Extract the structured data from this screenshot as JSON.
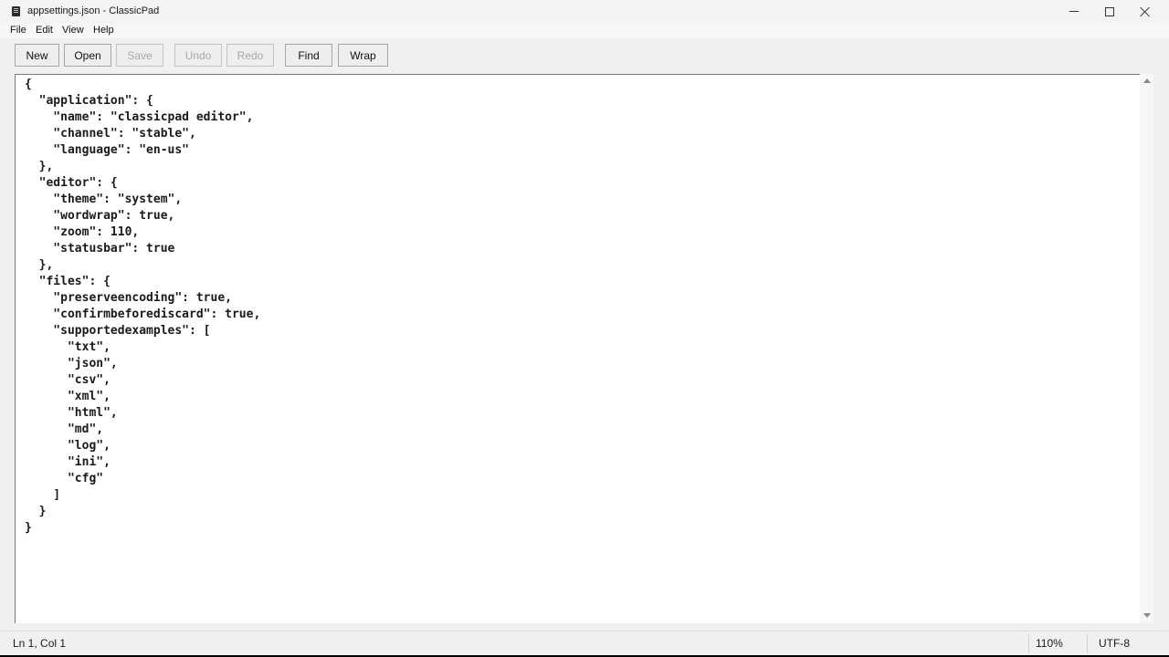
{
  "window": {
    "title": "appsettings.json - ClassicPad"
  },
  "titlebar_controls": {
    "minimize_icon": "minimize-icon",
    "maximize_icon": "maximize-icon",
    "close_icon": "close-icon"
  },
  "menu": {
    "items": [
      "File",
      "Edit",
      "View",
      "Help"
    ]
  },
  "toolbar": {
    "buttons": [
      {
        "label": "New",
        "enabled": true
      },
      {
        "label": "Open",
        "enabled": true
      },
      {
        "label": "Save",
        "enabled": false
      },
      {
        "label": "Undo",
        "enabled": false
      },
      {
        "label": "Redo",
        "enabled": false
      },
      {
        "label": "Find",
        "enabled": true
      },
      {
        "label": "Wrap",
        "enabled": true
      }
    ]
  },
  "editor": {
    "content": "{\n  \"application\": {\n    \"name\": \"classicpad editor\",\n    \"channel\": \"stable\",\n    \"language\": \"en-us\"\n  },\n  \"editor\": {\n    \"theme\": \"system\",\n    \"wordwrap\": true,\n    \"zoom\": 110,\n    \"statusbar\": true\n  },\n  \"files\": {\n    \"preserveencoding\": true,\n    \"confirmbeforediscard\": true,\n    \"supportedexamples\": [\n      \"txt\",\n      \"json\",\n      \"csv\",\n      \"xml\",\n      \"html\",\n      \"md\",\n      \"log\",\n      \"ini\",\n      \"cfg\"\n    ]\n  }\n}"
  },
  "statusbar": {
    "position": "Ln 1, Col 1",
    "zoom": "110%",
    "encoding": "UTF-8"
  },
  "colors": {
    "window_bg": "#f0f0f0",
    "editor_bg": "#ffffff",
    "disabled_text": "#a9a9a9"
  }
}
